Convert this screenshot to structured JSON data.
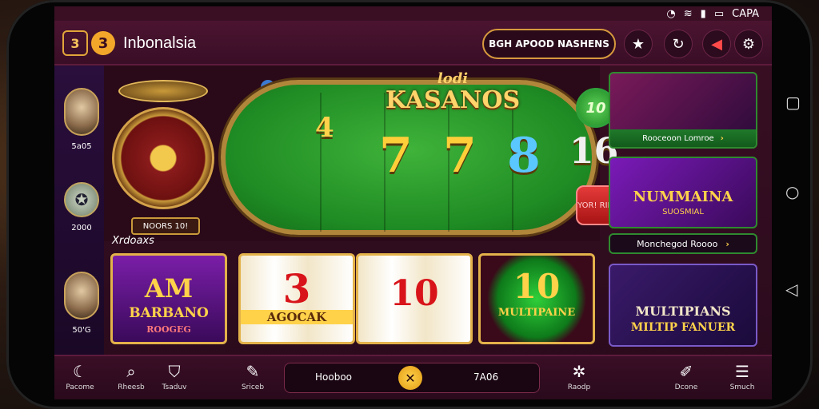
{
  "status_bar": {
    "carrier": "CAPA"
  },
  "header": {
    "brand_box": "3",
    "brand_num": "3",
    "brand_name": "Inbonalsia",
    "promo_text": "BGH APOOD NASHENS",
    "icons": [
      "star-icon",
      "refresh-icon",
      "megaphone-icon",
      "settings-icon"
    ]
  },
  "left_rail": {
    "items": [
      {
        "label": "5a05"
      },
      {
        "label": "2000"
      },
      {
        "label": "50'G"
      }
    ]
  },
  "table": {
    "title_sub": "lodi",
    "title_main": "KASANOS",
    "wheel_label": "NOORS 10!",
    "info": "i",
    "reel_symbols": [
      "4",
      "7",
      "7",
      "8",
      "16"
    ],
    "chip": "10",
    "dice_badge": "YOR! RIDEE"
  },
  "section_label": "Xrdoaxs",
  "tiles": [
    {
      "line1": "AM",
      "line2": "BARBANO",
      "line3": "ROOGEG"
    },
    {
      "line1": "3",
      "line2": "AGOCAK"
    },
    {
      "line1": "10"
    },
    {
      "line1": "10",
      "line2": "MULTIPAINE"
    }
  ],
  "promos": [
    {
      "bar": "Rooceoon Lomroe"
    },
    {
      "title": "NUMMAINA",
      "sub": "SUOSMIAL"
    },
    {
      "link": "Monchegod Roooo"
    },
    {
      "title1": "MULTIPIANS",
      "title2": "MILTIP FANUER"
    }
  ],
  "bottom_nav": {
    "items": [
      {
        "label": "Pacome"
      },
      {
        "label": "Rheesb"
      },
      {
        "label": "Tsaduv"
      },
      {
        "label": "Sriceb"
      },
      {
        "label": "Raodp"
      },
      {
        "label": "Dcone"
      },
      {
        "label": "Smuch"
      }
    ],
    "balance_left": "Hooboo",
    "balance_right": "7A06"
  },
  "colors": {
    "accent_gold": "#e3b24a",
    "felt_green": "#1e8a23",
    "bg_maroon": "#3a0e26"
  }
}
